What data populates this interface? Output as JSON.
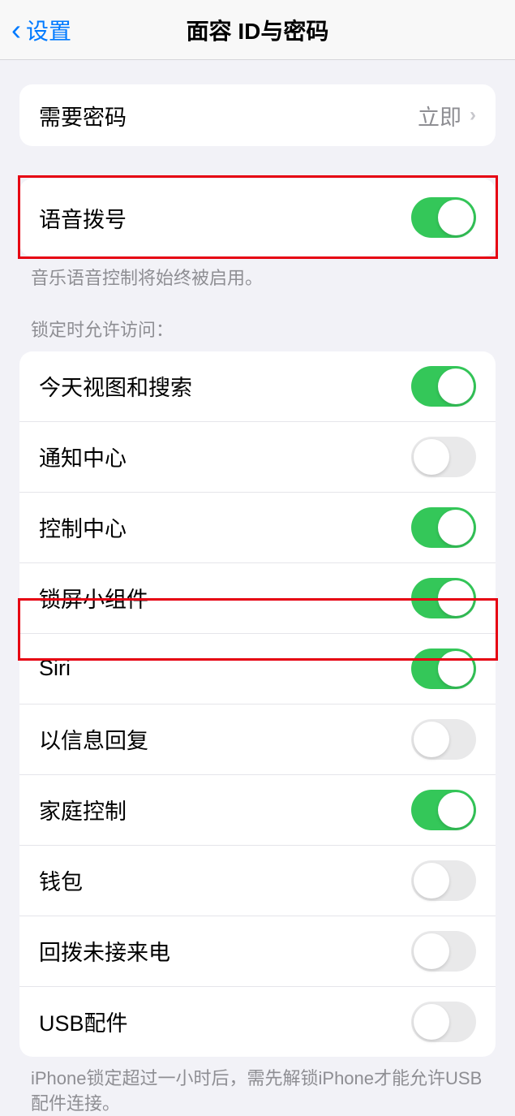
{
  "nav": {
    "back_label": "设置",
    "title": "面容 ID与密码"
  },
  "passcode_section": {
    "require_passcode": {
      "label": "需要密码",
      "value": "立即"
    }
  },
  "voice_dial": {
    "label": "语音拨号",
    "on": true,
    "footer": "音乐语音控制将始终被启用。"
  },
  "lock_access": {
    "header": "锁定时允许访问：",
    "items": [
      {
        "label": "今天视图和搜索",
        "on": true
      },
      {
        "label": "通知中心",
        "on": false
      },
      {
        "label": "控制中心",
        "on": true
      },
      {
        "label": "锁屏小组件",
        "on": true
      },
      {
        "label": "Siri",
        "on": true
      },
      {
        "label": "以信息回复",
        "on": false
      },
      {
        "label": "家庭控制",
        "on": true
      },
      {
        "label": "钱包",
        "on": false
      },
      {
        "label": "回拨未接来电",
        "on": false
      },
      {
        "label": "USB配件",
        "on": false
      }
    ],
    "footer": "iPhone锁定超过一小时后，需先解锁iPhone才能允许USB配件连接。"
  }
}
